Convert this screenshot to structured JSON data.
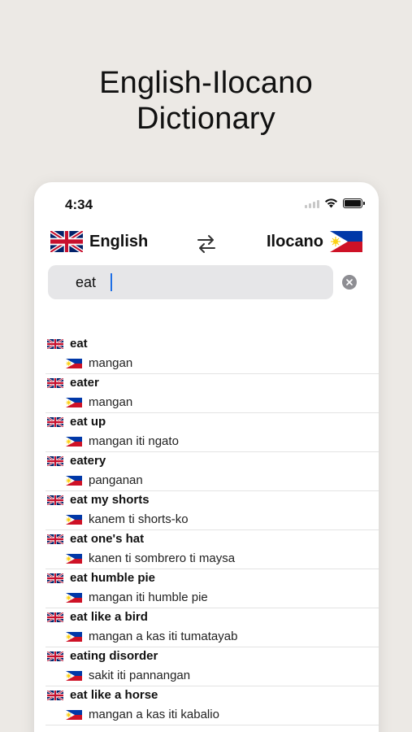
{
  "hero": {
    "title_line1": "English-Ilocano",
    "title_line2": "Dictionary"
  },
  "status": {
    "time": "4:34"
  },
  "languages": {
    "source": "English",
    "target": "Ilocano"
  },
  "search": {
    "value": "eat"
  },
  "results": [
    {
      "en": "eat",
      "il": "mangan"
    },
    {
      "en": "eater",
      "il": "mangan"
    },
    {
      "en": "eat up",
      "il": "mangan iti ngato"
    },
    {
      "en": "eatery",
      "il": "panganan"
    },
    {
      "en": "eat my shorts",
      "il": "kanem ti shorts-ko"
    },
    {
      "en": "eat one's hat",
      "il": "kanen ti sombrero ti maysa"
    },
    {
      "en": "eat humble pie",
      "il": "mangan iti humble pie"
    },
    {
      "en": "eat like a bird",
      "il": "mangan a kas iti tumatayab"
    },
    {
      "en": "eating disorder",
      "il": "sakit iti pannangan"
    },
    {
      "en": "eat like a horse",
      "il": "mangan a kas iti kabalio"
    }
  ],
  "colors": {
    "background": "#ece9e5",
    "caret": "#1f6fe5",
    "search_bg": "#e6e6e8"
  }
}
